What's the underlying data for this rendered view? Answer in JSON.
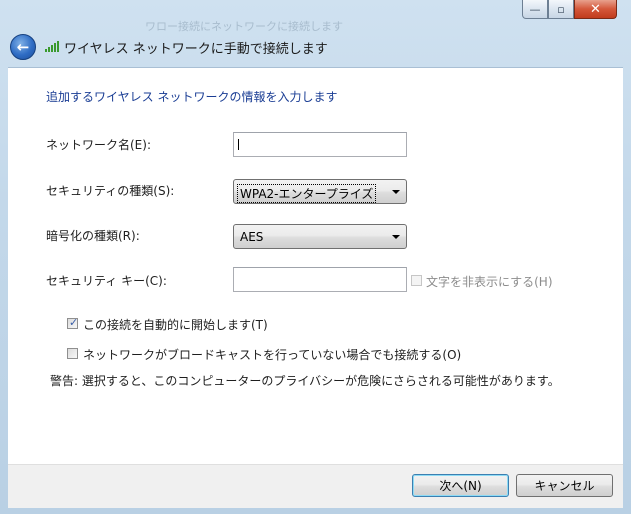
{
  "window": {
    "title": "ワイヤレス ネットワークに手動で接続します",
    "background_ghost_text": "ワロー接続にネットワークに接続します",
    "minimize_glyph": "—",
    "maximize_glyph": "▫",
    "close_glyph": "✕",
    "back_glyph": "←"
  },
  "heading": "追加するワイヤレス ネットワークの情報を入力します",
  "form": {
    "network_name": {
      "label": "ネットワーク名(E):",
      "value": ""
    },
    "security_type": {
      "label": "セキュリティの種類(S):",
      "selected": "WPA2-エンタープライズ"
    },
    "encryption_type": {
      "label": "暗号化の種類(R):",
      "selected": "AES"
    },
    "security_key": {
      "label": "セキュリティ キー(C):",
      "value": ""
    },
    "hide_chars": {
      "label": "文字を非表示にする(H)",
      "checked": false,
      "enabled": false
    }
  },
  "options": {
    "auto_connect": {
      "label": "この接続を自動的に開始します(T)",
      "checked": true
    },
    "connect_hidden": {
      "label": "ネットワークがブロードキャストを行っていない場合でも接続する(O)",
      "checked": false
    }
  },
  "warning": "警告: 選択すると、このコンピューターのプライバシーが危険にさらされる可能性があります。",
  "buttons": {
    "next": "次へ(N)",
    "cancel": "キャンセル"
  },
  "icons": {
    "back": "back-arrow-icon",
    "wireless": "wireless-signal-icon",
    "checkmark": "✓"
  },
  "colors": {
    "heading": "#1a3d94",
    "frame": "#c3d8ea",
    "content": "#ffffff",
    "footer": "#f0f0f0"
  }
}
